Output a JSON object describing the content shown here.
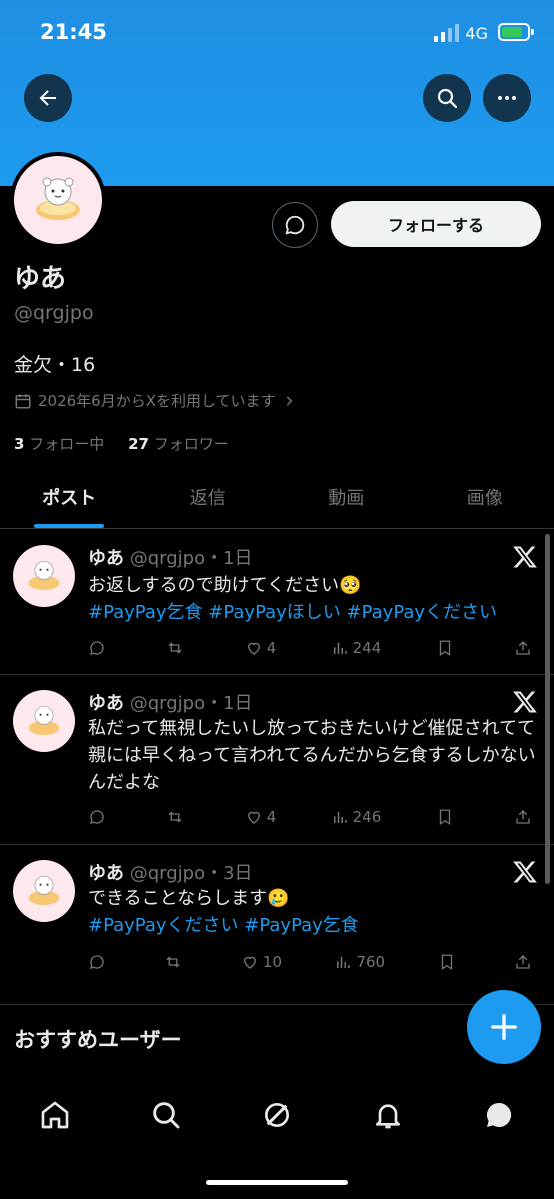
{
  "status_bar": {
    "time": "21:45",
    "network": "4G"
  },
  "profile": {
    "name": "ゆあ",
    "handle": "@qrgjpo",
    "bio": "金欠・16",
    "joined": "2026年6月からXを利用しています",
    "following_count": "3",
    "following_label": "フォロー中",
    "followers_count": "27",
    "followers_label": "フォロワー",
    "follow_button": "フォローする"
  },
  "tabs": [
    {
      "label": "ポスト",
      "active": true
    },
    {
      "label": "返信",
      "active": false
    },
    {
      "label": "動画",
      "active": false
    },
    {
      "label": "画像",
      "active": false
    }
  ],
  "posts": [
    {
      "name": "ゆあ",
      "handle": "@qrgjpo",
      "time": "・1日",
      "text": "お返しするので助けてください🥺",
      "hashtags": "#PayPay乞食 #PayPayほしい #PayPayください",
      "likes": "4",
      "views": "244"
    },
    {
      "name": "ゆあ",
      "handle": "@qrgjpo",
      "time": "・1日",
      "text": "私だって無視したいし放っておきたいけど催促されてて親には早くねって言われてるんだから乞食するしかないんだよな",
      "hashtags": "",
      "likes": "4",
      "views": "246"
    },
    {
      "name": "ゆあ",
      "handle": "@qrgjpo",
      "time": "・3日",
      "text": "できることならします🥲",
      "hashtags": "#PayPayください #PayPay乞食",
      "likes": "10",
      "views": "760"
    }
  ],
  "recommended_title": "おすすめユーザー",
  "colors": {
    "accent": "#1d9bf0",
    "background": "#000000",
    "muted": "#71767b"
  }
}
